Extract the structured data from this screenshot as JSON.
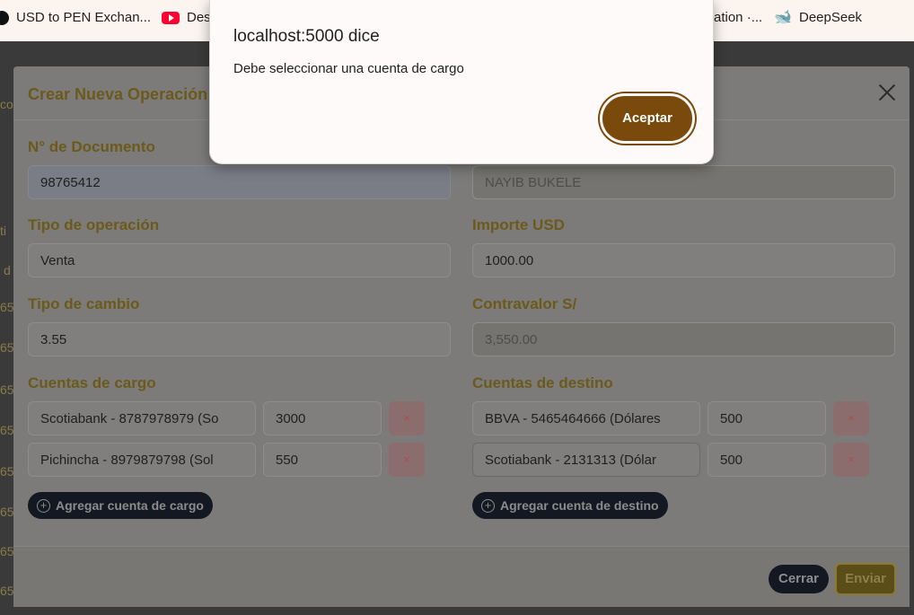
{
  "bookmarks": [
    {
      "icon": "exchange-icon",
      "label": "USD to PEN Exchan..."
    },
    {
      "icon": "youtube-icon",
      "label": "Des"
    },
    {
      "icon": "page-icon",
      "label": "ation ·..."
    },
    {
      "icon": "deepseek-icon",
      "label": "DeepSeek"
    }
  ],
  "behind": {
    "fragments": [
      "co",
      "ti",
      "d",
      "65",
      "65",
      "65",
      "65",
      "65",
      "65",
      "65",
      "65"
    ]
  },
  "modal": {
    "title": "Crear Nueva Operación",
    "fields": {
      "documento_label": "N° de Documento",
      "documento_value": "98765412",
      "nombre_value": "NAYIB BUKELE",
      "tipo_operacion_label": "Tipo de operación",
      "tipo_operacion_value": "Venta",
      "importe_label": "Importe USD",
      "importe_value": "1000.00",
      "tipo_cambio_label": "Tipo de cambio",
      "tipo_cambio_value": "3.55",
      "contravalor_label": "Contravalor S/",
      "contravalor_value": "3,550.00"
    },
    "cuentas_cargo": {
      "label": "Cuentas de cargo",
      "rows": [
        {
          "cuenta": "Scotiabank - 8787978979 (So",
          "monto": "3000"
        },
        {
          "cuenta": "Pichincha - 8979879798 (Sol",
          "monto": "550"
        }
      ],
      "add_label": "Agregar cuenta de cargo"
    },
    "cuentas_destino": {
      "label": "Cuentas de destino",
      "rows": [
        {
          "cuenta": "BBVA - 5465464666 (Dólares",
          "monto": "500"
        },
        {
          "cuenta": "Scotiabank - 2131313 (Dólar",
          "monto": "500"
        }
      ],
      "add_label": "Agregar cuenta de destino"
    },
    "remove_symbol": "×",
    "footer": {
      "cerrar_label": "Cerrar",
      "enviar_label": "Enviar"
    }
  },
  "alert": {
    "title": "localhost:5000 dice",
    "message": "Debe seleccionar una cuenta de cargo",
    "ok_label": "Aceptar"
  }
}
